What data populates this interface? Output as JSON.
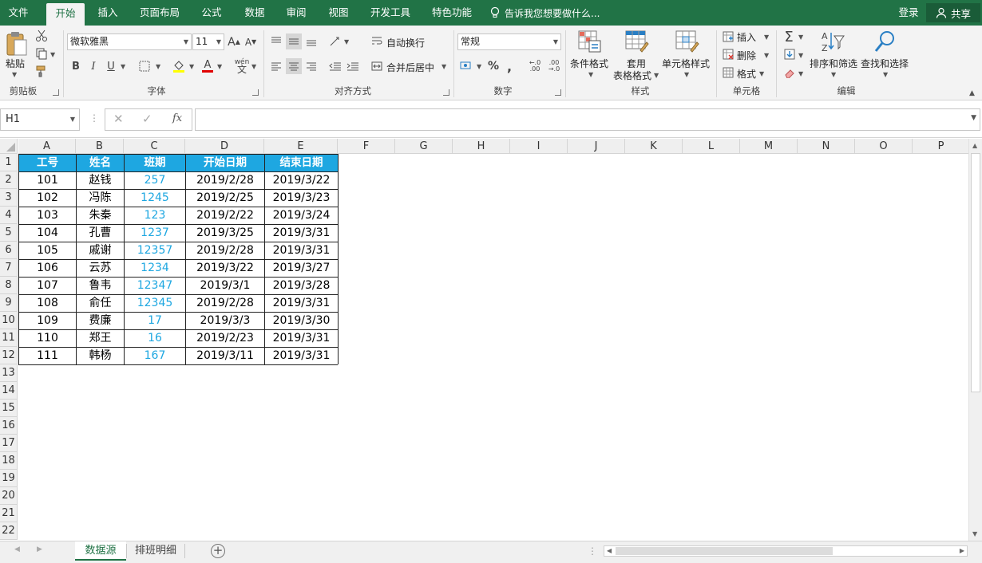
{
  "tabs": [
    {
      "label": "文件",
      "active": false
    },
    {
      "label": "开始",
      "active": true
    },
    {
      "label": "插入",
      "active": false
    },
    {
      "label": "页面布局",
      "active": false
    },
    {
      "label": "公式",
      "active": false
    },
    {
      "label": "数据",
      "active": false
    },
    {
      "label": "审阅",
      "active": false
    },
    {
      "label": "视图",
      "active": false
    },
    {
      "label": "开发工具",
      "active": false
    },
    {
      "label": "特色功能",
      "active": false
    }
  ],
  "tell_me": "告诉我您想要做什么...",
  "login": "登录",
  "share": "共享",
  "ribbon": {
    "clipboard": {
      "paste": "粘贴",
      "group": "剪贴板"
    },
    "font": {
      "name": "微软雅黑",
      "size": "11",
      "group": "字体",
      "bold": "B",
      "italic": "I",
      "underline": "U",
      "grow": "A",
      "shrink": "A",
      "color_a": "A",
      "wen": "wén"
    },
    "align": {
      "wrap": "自动换行",
      "merge": "合并后居中",
      "group": "对齐方式"
    },
    "number": {
      "format": "常规",
      "group": "数字",
      "percent": "%",
      "comma": ","
    },
    "styles": {
      "cond": "条件格式",
      "table1": "套用",
      "table2": "表格格式",
      "cell": "单元格样式",
      "group": "样式"
    },
    "cells": {
      "insert": "插入",
      "delete": "删除",
      "format": "格式",
      "group": "单元格"
    },
    "editing": {
      "sum": "Σ",
      "sort": "排序和筛选",
      "find": "查找和选择",
      "group": "编辑"
    }
  },
  "formula_bar": {
    "name_box": "H1",
    "fx": "fx",
    "value": ""
  },
  "columns": [
    "A",
    "B",
    "C",
    "D",
    "E",
    "F",
    "G",
    "H",
    "I",
    "J",
    "K",
    "L",
    "M",
    "N",
    "O",
    "P"
  ],
  "rows": [
    "1",
    "2",
    "3",
    "4",
    "5",
    "6",
    "7",
    "8",
    "9",
    "10",
    "11",
    "12",
    "13",
    "14",
    "15",
    "16",
    "17",
    "18",
    "19",
    "20",
    "21",
    "22"
  ],
  "table": {
    "headers": [
      "工号",
      "姓名",
      "班期",
      "开始日期",
      "结束日期"
    ],
    "rows": [
      [
        "101",
        "赵钱",
        "257",
        "2019/2/28",
        "2019/3/22"
      ],
      [
        "102",
        "冯陈",
        "1245",
        "2019/2/25",
        "2019/3/23"
      ],
      [
        "103",
        "朱秦",
        "123",
        "2019/2/22",
        "2019/3/24"
      ],
      [
        "104",
        "孔曹",
        "1237",
        "2019/3/25",
        "2019/3/31"
      ],
      [
        "105",
        "戚谢",
        "12357",
        "2019/2/28",
        "2019/3/31"
      ],
      [
        "106",
        "云苏",
        "1234",
        "2019/3/22",
        "2019/3/27"
      ],
      [
        "107",
        "鲁韦",
        "12347",
        "2019/3/1",
        "2019/3/28"
      ],
      [
        "108",
        "俞任",
        "12345",
        "2019/2/28",
        "2019/3/31"
      ],
      [
        "109",
        "费廉",
        "17",
        "2019/3/3",
        "2019/3/30"
      ],
      [
        "110",
        "郑王",
        "16",
        "2019/2/23",
        "2019/3/31"
      ],
      [
        "111",
        "韩杨",
        "167",
        "2019/3/11",
        "2019/3/31"
      ]
    ]
  },
  "sheets": [
    {
      "label": "数据源",
      "active": true
    },
    {
      "label": "排班明细",
      "active": false
    }
  ],
  "colors": {
    "accent": "#217346",
    "header_fill": "#1ea7e1"
  }
}
